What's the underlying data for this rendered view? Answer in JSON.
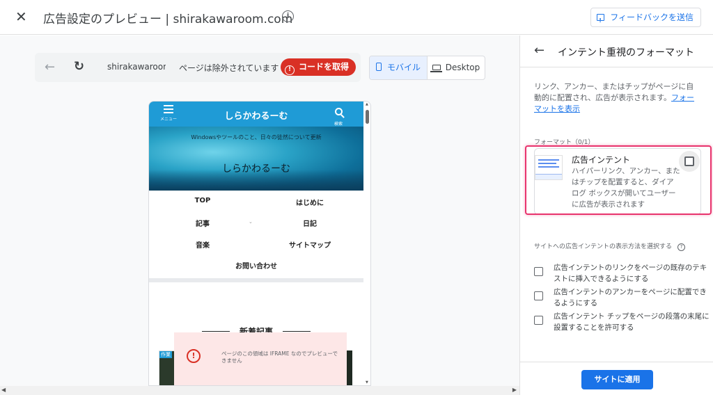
{
  "header": {
    "title": "広告設定のプレビュー | shirakawaroom.com",
    "feedback_label": "フィードバックを送信"
  },
  "toolbar": {
    "url": "shirakawaroom",
    "status": "ページは除外されています",
    "get_code_label": "コードを取得",
    "device_mobile": "モバイル",
    "device_desktop": "Desktop",
    "device_selected": "モバイル"
  },
  "site_preview": {
    "menu_label": "メニュー",
    "search_label": "検索",
    "site_name": "しらかわるーむ",
    "tagline": "Windowsやツールのこと、日々の徒然について更新",
    "hero_name": "しらかわるーむ",
    "nav": [
      "TOP",
      "はじめに",
      "記事",
      "日記",
      "音楽",
      "サイトマップ",
      "お問い合わせ"
    ],
    "new_posts_heading": "新着記事",
    "card_tag": "作業",
    "iframe_notice": "ページのこの領域は IFRAME なのでプレビューできません"
  },
  "panel": {
    "title": "インテント重視のフォーマット",
    "description": "リンク、アンカー、またはチップがページに自動的に配置され、広告が表示されます。",
    "description_link": "フォーマットを表示",
    "formats_label": "フォーマット（0/1）",
    "format_title": "広告インテント",
    "format_body": "ハイパーリンク、アンカー、またはチップを配置すると、ダイアログ ボックスが開いてユーザーに広告が表示されます",
    "format_checked": false,
    "method_label": "サイトへの広告インテントの表示方法を選択する",
    "options": [
      {
        "label": "広告インテントのリンクをページの既存のテキストに挿入できるようにする",
        "checked": false
      },
      {
        "label": "広告インテントのアンカーをページに配置できるようにする",
        "checked": false
      },
      {
        "label": "広告インテント チップをページの段落の末尾に設置することを許可する",
        "checked": false
      }
    ],
    "apply_label": "サイトに適用"
  },
  "colors": {
    "accent": "#1a73e8",
    "error": "#d93025",
    "highlight": "#e8336d",
    "site_header": "#1f9bd6"
  }
}
